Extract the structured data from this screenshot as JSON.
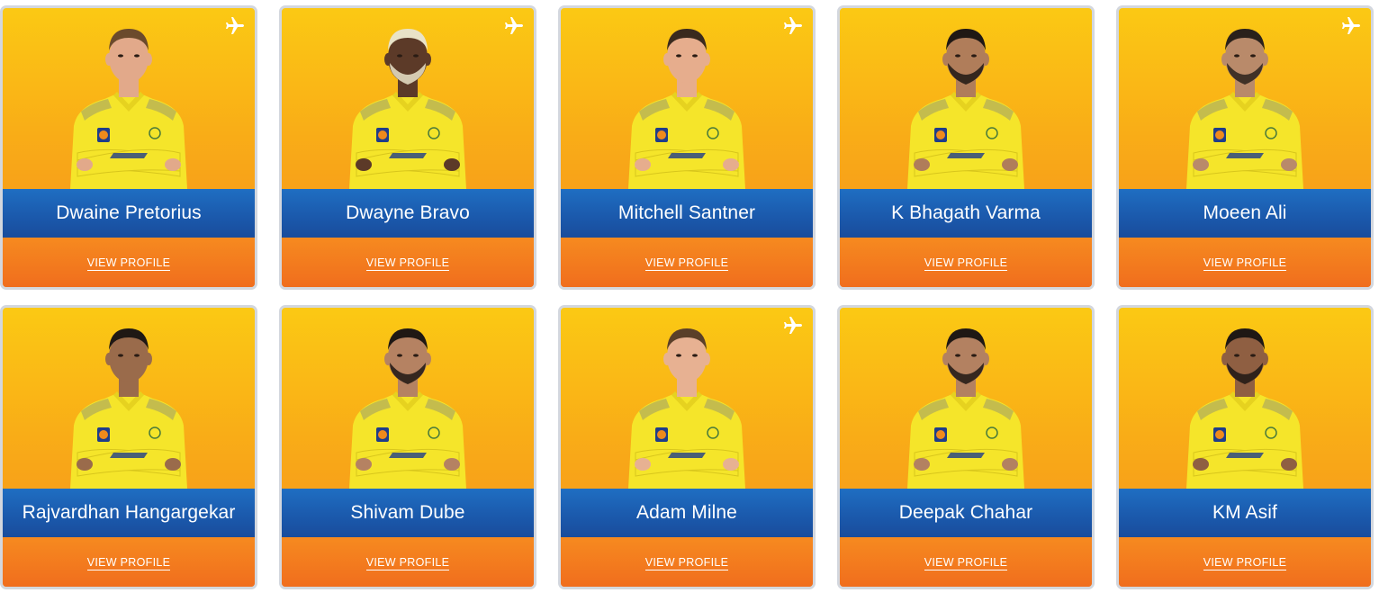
{
  "cta_label": "VIEW PROFILE",
  "colors": {
    "card_top": "#fbc914",
    "card_bottom": "#f58d1d",
    "name_band": "#1b5aad",
    "cta_band": "#f06c1e",
    "jersey": "#f5e52a",
    "card_border": "#d3d7de"
  },
  "icons": {
    "travel": "airplane-icon"
  },
  "players": [
    {
      "name": "Dwaine Pretorius",
      "overseas": true,
      "skin": "#e2a98a",
      "hair": "#6b4a2c",
      "beard": false
    },
    {
      "name": "Dwayne Bravo",
      "overseas": true,
      "skin": "#5c3a28",
      "hair": "#e9e3c8",
      "beard": true
    },
    {
      "name": "Mitchell Santner",
      "overseas": true,
      "skin": "#e6ad8d",
      "hair": "#3a2a1e",
      "beard": false
    },
    {
      "name": "K Bhagath Varma",
      "overseas": false,
      "skin": "#b07d5a",
      "hair": "#1f1814",
      "beard": true
    },
    {
      "name": "Moeen Ali",
      "overseas": true,
      "skin": "#b98a6a",
      "hair": "#2a211b",
      "beard": true
    },
    {
      "name": "Rajvardhan Hangargekar",
      "overseas": false,
      "skin": "#9a6b4b",
      "hair": "#1f1814",
      "beard": false
    },
    {
      "name": "Shivam Dube",
      "overseas": false,
      "skin": "#b58262",
      "hair": "#1f1814",
      "beard": true
    },
    {
      "name": "Adam Milne",
      "overseas": true,
      "skin": "#e7b192",
      "hair": "#5a3f29",
      "beard": false
    },
    {
      "name": "Deepak Chahar",
      "overseas": false,
      "skin": "#b38161",
      "hair": "#1f1814",
      "beard": true
    },
    {
      "name": "KM Asif",
      "overseas": false,
      "skin": "#8f5f42",
      "hair": "#1f1814",
      "beard": true
    }
  ]
}
